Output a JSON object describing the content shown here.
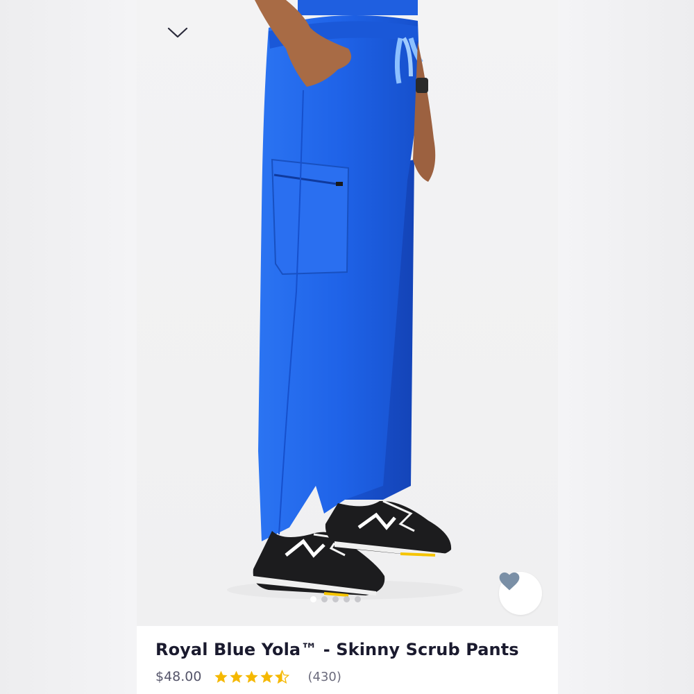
{
  "product": {
    "title": "Royal Blue Yola™ - Skinny Scrub Pants",
    "price": "$48.00",
    "rating": 4.5,
    "rating_max": 5,
    "review_count": "(430)"
  },
  "gallery": {
    "image_count": 5,
    "active_index": 0
  },
  "icons": {
    "collapse": "chevron-down-icon",
    "favorite": "heart-icon",
    "rating": "star-icon"
  },
  "colors": {
    "pants": "#1f63e8",
    "star": "#f5b800",
    "heart": "#7a8fa6",
    "title": "#1a1a2e"
  }
}
